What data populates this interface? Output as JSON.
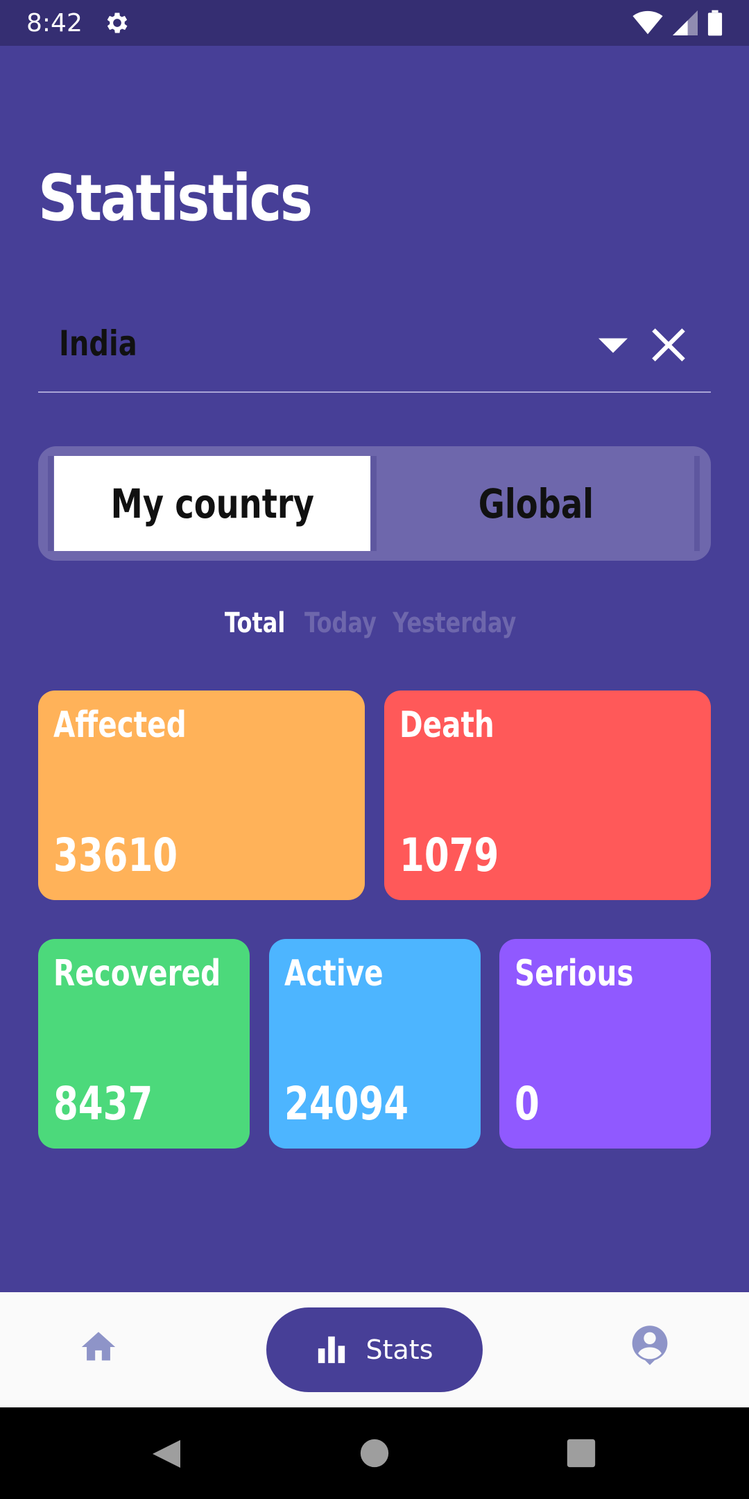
{
  "status_bar": {
    "time": "8:42"
  },
  "page_title": "Statistics",
  "country_select": {
    "value": "India"
  },
  "toggle": {
    "my_country": "My country",
    "global": "Global"
  },
  "period_tabs": {
    "total": "Total",
    "today": "Today",
    "yesterday": "Yesterday"
  },
  "cards": {
    "affected": {
      "label": "Affected",
      "value": "33610",
      "color": "#FFB259"
    },
    "death": {
      "label": "Death",
      "value": "1079",
      "color": "#FF5959"
    },
    "recovered": {
      "label": "Recovered",
      "value": "8437",
      "color": "#4CD97B"
    },
    "active": {
      "label": "Active",
      "value": "24094",
      "color": "#4DB5FF"
    },
    "serious": {
      "label": "Serious",
      "value": "0",
      "color": "#9059FF"
    }
  },
  "bottom_nav": {
    "home_icon": "home-icon",
    "stats_label": "Stats",
    "stats_icon": "bar-chart-icon",
    "profile_icon": "account-icon"
  },
  "theme": {
    "background": "#473F97",
    "status_bar": "#352E72"
  }
}
